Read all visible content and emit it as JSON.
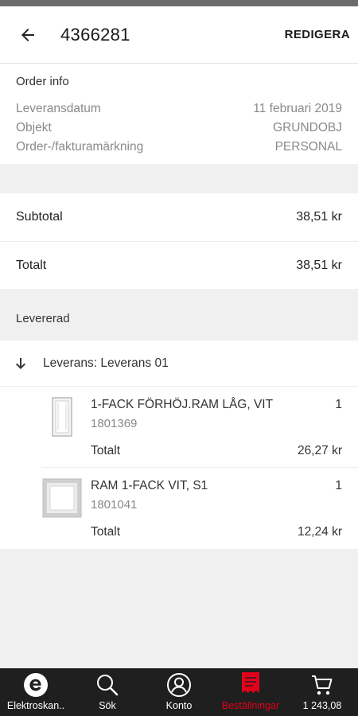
{
  "header": {
    "title": "4366281",
    "edit_label": "REDIGERA"
  },
  "order_info": {
    "title": "Order info",
    "rows": [
      {
        "label": "Leveransdatum",
        "value": "11 februari 2019"
      },
      {
        "label": "Objekt",
        "value": "GRUNDOBJ"
      },
      {
        "label": "Order-/fakturamärkning",
        "value": "PERSONAL"
      }
    ]
  },
  "totals": [
    {
      "label": "Subtotal",
      "value": "38,51 kr"
    },
    {
      "label": "Totalt",
      "value": "38,51 kr"
    }
  ],
  "delivered": {
    "title": "Levererad",
    "delivery_label": "Leverans: Leverans 01",
    "items": [
      {
        "name": "1-FACK FÖRHÖJ.RAM LÅG, VIT",
        "sku": "1801369",
        "qty": "1",
        "total_label": "Totalt",
        "total": "26,27 kr"
      },
      {
        "name": "RAM 1-FACK VIT, S1",
        "sku": "1801041",
        "qty": "1",
        "total_label": "Totalt",
        "total": "12,24 kr"
      }
    ]
  },
  "nav": [
    {
      "label": "Elektroskan..",
      "icon": "brand-e-icon"
    },
    {
      "label": "Sök",
      "icon": "search-icon"
    },
    {
      "label": "Konto",
      "icon": "account-icon"
    },
    {
      "label": "Beställningar",
      "icon": "orders-icon",
      "active": true
    },
    {
      "label": "1 243,08",
      "icon": "cart-icon"
    }
  ],
  "colors": {
    "accent": "#e3001b",
    "navbar": "#1f1f1f",
    "background": "#f0f0f0"
  }
}
